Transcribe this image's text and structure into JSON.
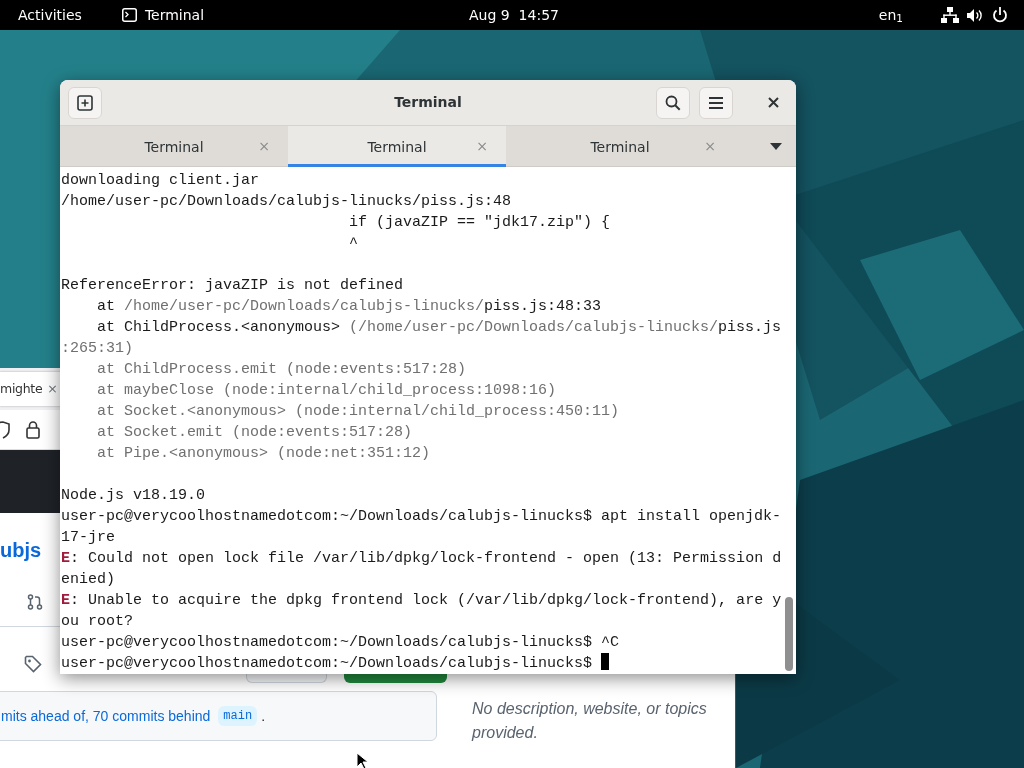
{
  "top_bar": {
    "activities": "Activities",
    "app": "Terminal",
    "clock": "Aug 9  14:57",
    "keyboard": "en$_{1}$"
  },
  "browser": {
    "tab": "mighte",
    "tab_close": "×",
    "repo": "ubjs",
    "compare": "mits ahead of, 70 commits behind",
    "branch": "main",
    "compare_end": ".",
    "about": "No description, website, or topics provided."
  },
  "terminal": {
    "title": "Terminal",
    "tabs": [
      {
        "label": "Terminal",
        "close": "×",
        "selected": false
      },
      {
        "label": "Terminal",
        "close": "×",
        "selected": true
      },
      {
        "label": "Terminal",
        "close": "×",
        "selected": false
      }
    ],
    "lines": [
      {
        "segments": [
          {
            "kind": "plain",
            "text": "downloading client.jar"
          }
        ]
      },
      {
        "segments": [
          {
            "kind": "plain",
            "text": "/home/user-pc/Downloads/calubjs-linucks/piss.js:48"
          }
        ]
      },
      {
        "segments": [
          {
            "kind": "plain",
            "text": "                                if (javaZIP == \"jdk17.zip\") {"
          }
        ]
      },
      {
        "segments": [
          {
            "kind": "plain",
            "text": "                                ^"
          }
        ]
      },
      {
        "blank_before": true,
        "segments": [
          {
            "kind": "plain",
            "text": "ReferenceError: javaZIP is not defined"
          }
        ]
      },
      {
        "segments": [
          {
            "kind": "plain",
            "text": "    at "
          },
          {
            "kind": "dim",
            "text": "/home/user-pc/Downloads/calubjs-linucks/"
          },
          {
            "kind": "plain",
            "text": "piss.js:48:33"
          }
        ]
      },
      {
        "segments": [
          {
            "kind": "plain",
            "text": "    at ChildProcess.<anonymous> "
          },
          {
            "kind": "dim",
            "text": "(/home/user-pc/Downloads/calubjs-linucks/"
          },
          {
            "kind": "plain",
            "text": "piss.js"
          }
        ]
      },
      {
        "segments": [
          {
            "kind": "dim",
            "text": ":265:31)"
          }
        ]
      },
      {
        "segments": [
          {
            "kind": "dim",
            "text": "    at ChildProcess.emit (node:events:517:28)"
          }
        ]
      },
      {
        "segments": [
          {
            "kind": "dim",
            "text": "    at maybeClose (node:internal/child_process:1098:16)"
          }
        ]
      },
      {
        "segments": [
          {
            "kind": "dim",
            "text": "    at Socket.<anonymous> (node:internal/child_process:450:11)"
          }
        ]
      },
      {
        "segments": [
          {
            "kind": "dim",
            "text": "    at Socket.emit (node:events:517:28)"
          }
        ]
      },
      {
        "segments": [
          {
            "kind": "dim",
            "text": "    at Pipe.<anonymous> (node:net:351:12)"
          }
        ]
      },
      {
        "blank_before": true,
        "segments": [
          {
            "kind": "plain",
            "text": "Node.js v18.19.0"
          }
        ]
      },
      {
        "segments": [
          {
            "kind": "plain",
            "text": "user-pc@verycoolhostnamedotcom:~/Downloads/calubjs-linucks$ apt install openjdk-"
          }
        ]
      },
      {
        "segments": [
          {
            "kind": "plain",
            "text": "17-jre"
          }
        ]
      },
      {
        "segments": [
          {
            "kind": "error",
            "text": "E"
          },
          {
            "kind": "plain",
            "text": ": Could not open lock file /var/lib/dpkg/lock-frontend - open (13: Permission d"
          }
        ]
      },
      {
        "segments": [
          {
            "kind": "plain",
            "text": "enied)"
          }
        ]
      },
      {
        "segments": [
          {
            "kind": "error",
            "text": "E"
          },
          {
            "kind": "plain",
            "text": ": Unable to acquire the dpkg frontend lock (/var/lib/dpkg/lock-frontend), are y"
          }
        ]
      },
      {
        "segments": [
          {
            "kind": "plain",
            "text": "ou root?"
          }
        ]
      },
      {
        "segments": [
          {
            "kind": "plain",
            "text": "user-pc@verycoolhostnamedotcom:~/Downloads/calubjs-linucks$ ^C"
          }
        ]
      },
      {
        "cursor": true,
        "segments": [
          {
            "kind": "plain",
            "text": "user-pc@verycoolhostnamedotcom:~/Downloads/calubjs-linucks$ "
          }
        ]
      }
    ]
  }
}
